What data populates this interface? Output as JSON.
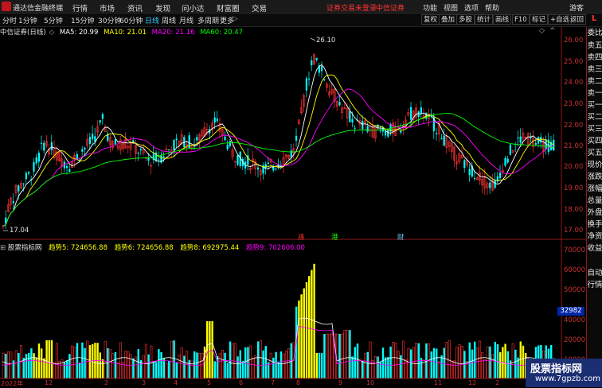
{
  "menubar": {
    "app_title": "通达信金融终端",
    "items": [
      "行情",
      "市场",
      "资讯",
      "发现",
      "问小达",
      "财富圈",
      "交易"
    ],
    "login_notice": "证券交易未登录",
    "broker": "中信证券",
    "right_items": [
      "功能",
      "视图",
      "选项",
      "帮助"
    ],
    "guest": "游客"
  },
  "toolbar": {
    "periods": [
      "分时",
      "1分钟",
      "5分钟",
      "15分钟",
      "30分钟",
      "60分钟",
      "日线",
      "周线",
      "月线",
      "多周期",
      "更多"
    ],
    "active_period": "日线",
    "more_arrow": "▷",
    "tools": [
      "复权",
      "叠加",
      "多股",
      "统计",
      "画线",
      "F10",
      "标记",
      "+自选",
      "返回"
    ]
  },
  "infobar": {
    "stock": "中信证券(日线)",
    "ma5": "MA5: 20.99",
    "ma10": "MA10: 21.01",
    "ma20": "MA20: 21.16",
    "ma60": "MA60: 20.47"
  },
  "chart": {
    "high_label": "26.10",
    "low_label": "17.04",
    "y_ticks": [
      "26.00",
      "25.00",
      "24.00",
      "23.00",
      "22.00",
      "21.00",
      "20.00",
      "19.00",
      "18.00",
      "17.00"
    ],
    "events": [
      "孫",
      "港",
      "财"
    ]
  },
  "indicator": {
    "name": "股票指标网",
    "t5": "趋势5: 724656.88",
    "t6": "趋势6: 724656.88",
    "t8": "趋势8: 692975.44",
    "t9": "趋势9: 702606.00",
    "y_ticks": [
      "70000",
      "60000",
      "50000",
      "40000",
      "20000",
      "10000"
    ],
    "badge": "32982"
  },
  "x_axis": [
    "2022年",
    "12",
    "2",
    "3",
    "4",
    "5",
    "6",
    "7",
    "8",
    "9",
    "10",
    "11",
    "12",
    "2"
  ],
  "sidebar": {
    "tag": "L",
    "items": [
      "委比",
      "卖五",
      "卖四",
      "卖三",
      "卖二",
      "卖一",
      "买一",
      "买二",
      "买三",
      "买四",
      "买五",
      "现价",
      "涨跌",
      "涨幅",
      "总量",
      "外盘",
      "换手",
      "净资",
      "收益",
      "",
      "自动",
      "行情"
    ]
  },
  "watermark": {
    "title": "股票指标网",
    "url": "www.7gpzb.com"
  },
  "colors": {
    "up": "#ff3232",
    "down": "#00ffff",
    "ma5": "#ffffff",
    "ma10": "#ffff00",
    "ma20": "#ff00ff",
    "ma60": "#00ff00",
    "axis": "#c83232",
    "volume": "#ffff00"
  }
}
